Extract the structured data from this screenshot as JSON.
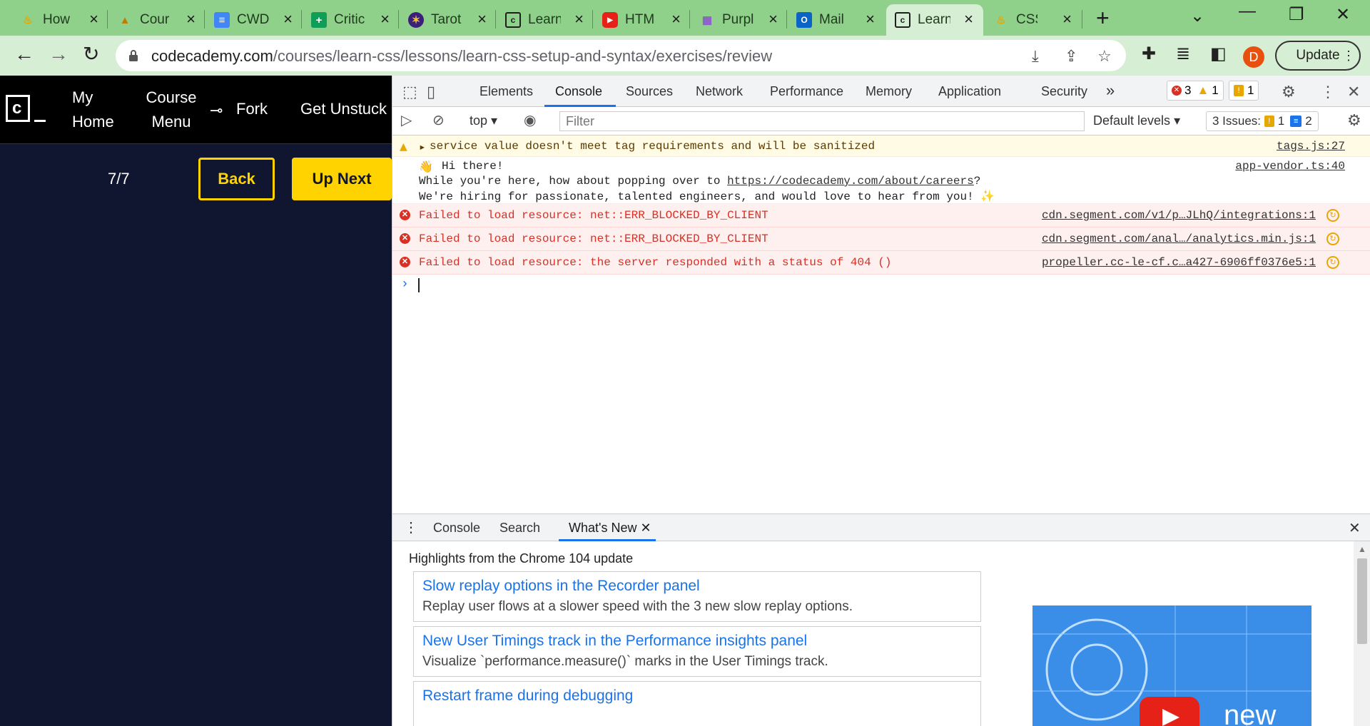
{
  "browser": {
    "tabs": [
      {
        "label": "How",
        "icon": "fire-icon",
        "color": "#e8a600"
      },
      {
        "label": "Cour",
        "icon": "course-icon",
        "color": "#c47a00"
      },
      {
        "label": "CWD",
        "icon": "docs-icon",
        "color": "#4285f4"
      },
      {
        "label": "Critic",
        "icon": "sheets-icon",
        "color": "#0f9d58"
      },
      {
        "label": "Tarot",
        "icon": "tarot-icon",
        "color": "#3b1f7a"
      },
      {
        "label": "Learn",
        "icon": "codecademy-icon",
        "color": "#1f1f1f"
      },
      {
        "label": "HTM",
        "icon": "youtube-icon",
        "color": "#e62117"
      },
      {
        "label": "Purpl",
        "icon": "purple-grid-icon",
        "color": "#8a5cc8"
      },
      {
        "label": "Mail",
        "icon": "outlook-icon",
        "color": "#0a64c8"
      },
      {
        "label": "Learn",
        "icon": "codecademy-icon",
        "color": "#1f1f1f",
        "active": true
      },
      {
        "label": "CSS",
        "icon": "fire-icon",
        "color": "#e8a600"
      }
    ],
    "new_tab": "+",
    "url_host": "codecademy.com",
    "url_path": "/courses/learn-css/lessons/learn-css-setup-and-syntax/exercises/review",
    "avatar_letter": "D",
    "update_label": "Update"
  },
  "codecademy": {
    "nav": {
      "my_home": "My Home",
      "course_menu": "Course Menu",
      "fork": "Fork",
      "get_unstuck": "Get Unstuck"
    },
    "progress": "7/7",
    "back_label": "Back",
    "next_label": "Up Next"
  },
  "devtools": {
    "tabs": [
      "Elements",
      "Console",
      "Sources",
      "Network",
      "Performance",
      "Memory",
      "Application",
      "Security"
    ],
    "more": "»",
    "error_count": "3",
    "warning_count": "1",
    "issue_count": "1",
    "context": "top",
    "filter_placeholder": "Filter",
    "levels": "Default levels",
    "issues_label": "3 Issues:",
    "issues_warn": "1",
    "issues_info": "2"
  },
  "console": {
    "warn": {
      "text": "service value doesn't meet tag requirements and will be sanitized",
      "source": "tags.js:27"
    },
    "info": {
      "line1": "Hi there!",
      "line2_pre": "While you're here, how about popping over to ",
      "line2_link": "https://codecademy.com/about/careers",
      "line2_post": "?",
      "line3": "We're hiring for passionate, talented engineers, and would love to hear from you!",
      "source": "app-vendor.ts:40"
    },
    "errors": [
      {
        "text": "Failed to load resource: net::ERR_BLOCKED_BY_CLIENT",
        "source": "cdn.segment.com/v1/p…JLhQ/integrations:1"
      },
      {
        "text": "Failed to load resource: net::ERR_BLOCKED_BY_CLIENT",
        "source": "cdn.segment.com/anal…/analytics.min.js:1"
      },
      {
        "text": "Failed to load resource: the server responded with a status of 404 ()",
        "source": "propeller.cc-le-cf.c…a427-6906ff0376e5:1"
      }
    ]
  },
  "drawer": {
    "tabs": [
      "Console",
      "Search",
      "What's New"
    ],
    "heading": "Highlights from the Chrome 104 update",
    "cards": [
      {
        "title": "Slow replay options in the Recorder panel",
        "desc": "Replay user flows at a slower speed with the 3 new slow replay options."
      },
      {
        "title": "New User Timings track in the Performance insights panel",
        "desc": "Visualize `performance.measure()` marks in the User Timings track."
      },
      {
        "title": "Restart frame during debugging",
        "desc": ""
      }
    ],
    "video_text": "new"
  }
}
